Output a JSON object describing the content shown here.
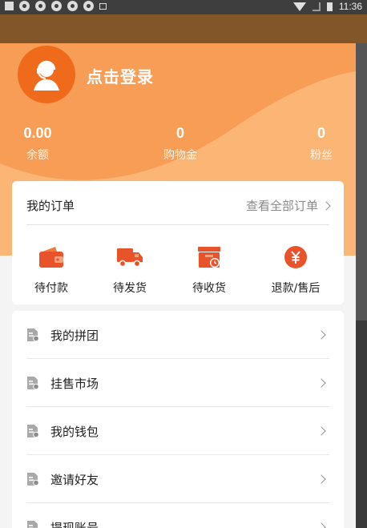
{
  "status_bar": {
    "time": "11:36",
    "icons": [
      "notification-square-icon",
      "gear-icon",
      "gear-icon",
      "gear-icon",
      "gear-icon",
      "gear-icon",
      "mail-icon",
      "wifi-icon",
      "no-signal-icon",
      "battery-icon"
    ]
  },
  "profile": {
    "login_text": "点击登录",
    "avatar_icon": "user-headset-icon"
  },
  "stats": [
    {
      "value": "0.00",
      "label": "余额"
    },
    {
      "value": "0",
      "label": "购物金"
    },
    {
      "value": "0",
      "label": "粉丝"
    }
  ],
  "orders": {
    "title": "我的订单",
    "view_all": "查看全部订单",
    "items": [
      {
        "label": "待付款",
        "icon": "wallet-icon"
      },
      {
        "label": "待发货",
        "icon": "truck-icon"
      },
      {
        "label": "待收货",
        "icon": "package-clock-icon"
      },
      {
        "label": "退款/售后",
        "icon": "yen-circle-icon"
      }
    ]
  },
  "menu": {
    "items": [
      {
        "label": "我的拼团",
        "icon": "document-icon"
      },
      {
        "label": "挂售市场",
        "icon": "document-icon"
      },
      {
        "label": "我的钱包",
        "icon": "document-icon"
      },
      {
        "label": "邀请好友",
        "icon": "document-icon"
      },
      {
        "label": "提现账号",
        "icon": "document-icon"
      }
    ]
  },
  "colors": {
    "accent": "#f06a1c",
    "header_orange": "#f79d55",
    "header_light": "#fbb676",
    "top_band": "#83562a",
    "icon_red": "#e8532a"
  }
}
